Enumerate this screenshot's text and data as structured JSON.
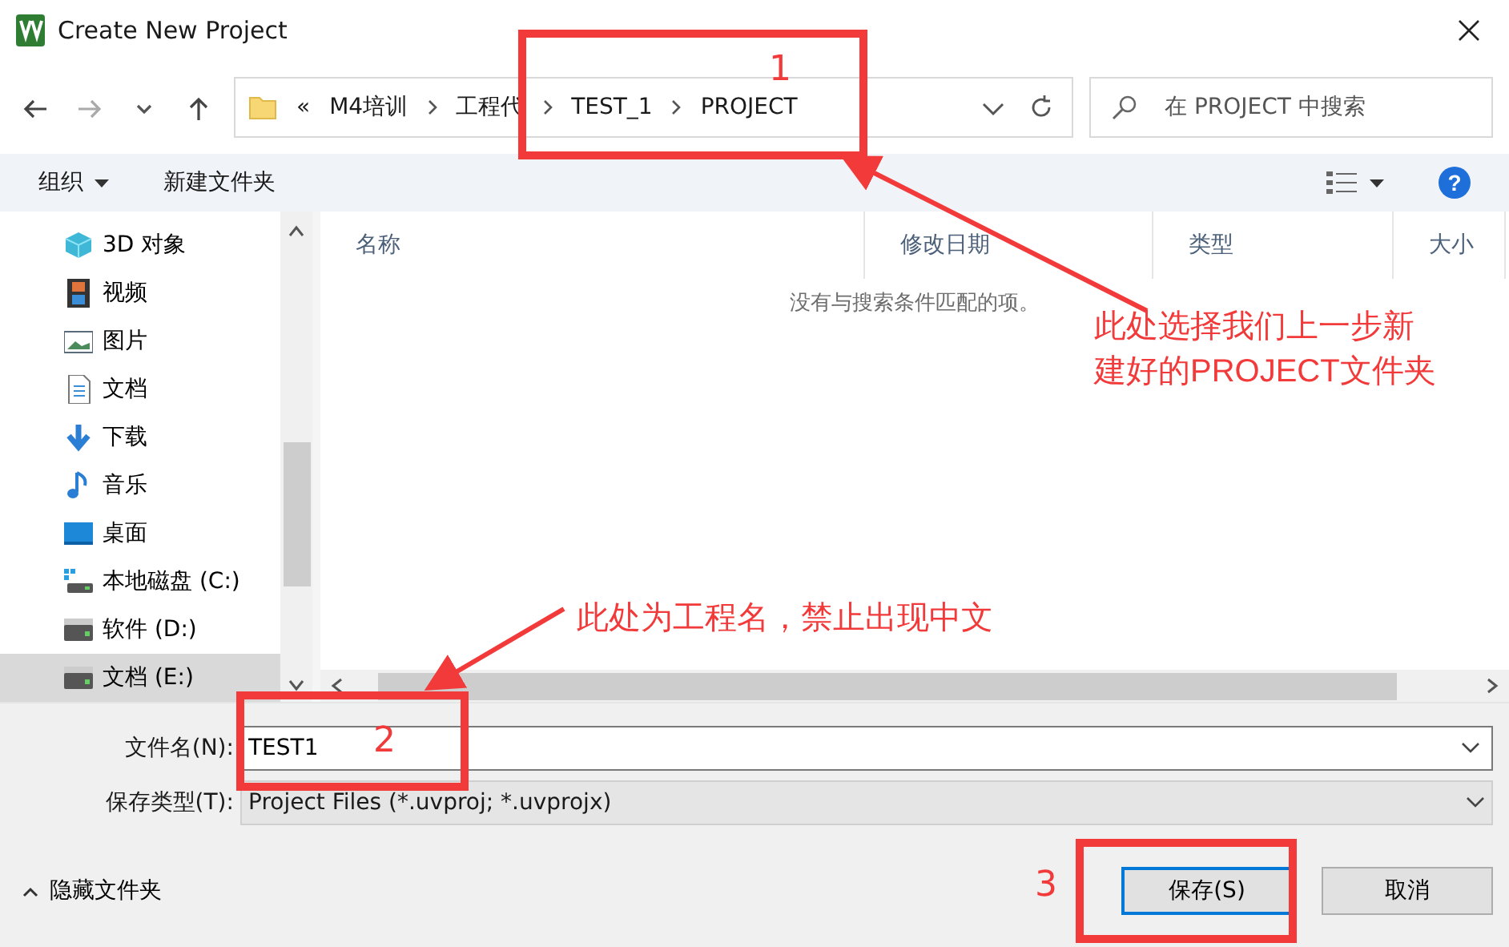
{
  "window": {
    "title": "Create New Project"
  },
  "address_bar": {
    "overflow": "«",
    "path": [
      {
        "label": "M4培训"
      },
      {
        "label": "工程代"
      },
      {
        "label": "TEST_1"
      },
      {
        "label": "PROJECT"
      }
    ]
  },
  "search": {
    "placeholder": "在 PROJECT 中搜索"
  },
  "toolbar": {
    "organize": "组织",
    "new_folder": "新建文件夹",
    "help": "?"
  },
  "sidebar": {
    "items": [
      {
        "label": "3D 对象",
        "kind": "cube",
        "selected": false
      },
      {
        "label": "视频",
        "kind": "film",
        "selected": false
      },
      {
        "label": "图片",
        "kind": "picture",
        "selected": false
      },
      {
        "label": "文档",
        "kind": "document",
        "selected": false
      },
      {
        "label": "下载",
        "kind": "download",
        "selected": false
      },
      {
        "label": "音乐",
        "kind": "music",
        "selected": false
      },
      {
        "label": "桌面",
        "kind": "desktop",
        "selected": false
      },
      {
        "label": "本地磁盘 (C:)",
        "kind": "systemdrive",
        "selected": false
      },
      {
        "label": "软件 (D:)",
        "kind": "drive",
        "selected": false
      },
      {
        "label": "文档 (E:)",
        "kind": "drive",
        "selected": true
      }
    ]
  },
  "file_list": {
    "columns": [
      "名称",
      "修改日期",
      "类型",
      "大小"
    ],
    "empty_message": "没有与搜索条件匹配的项。"
  },
  "file_name": {
    "label": "文件名(N):",
    "value": "TEST1"
  },
  "save_type": {
    "label": "保存类型(T):",
    "value": "Project Files (*.uvproj; *.uvprojx)"
  },
  "hide_folders": "隐藏文件夹",
  "buttons": [
    {
      "label": "保存(S)",
      "kind": "default"
    },
    {
      "label": "取消",
      "kind": "normal"
    }
  ],
  "annotations": [
    {
      "number": "1",
      "note": "此处选择我们上一步新建好的PROJECT文件夹"
    },
    {
      "number": "2",
      "note": "此处为工程名，禁止出现中文"
    },
    {
      "number": "3"
    }
  ]
}
